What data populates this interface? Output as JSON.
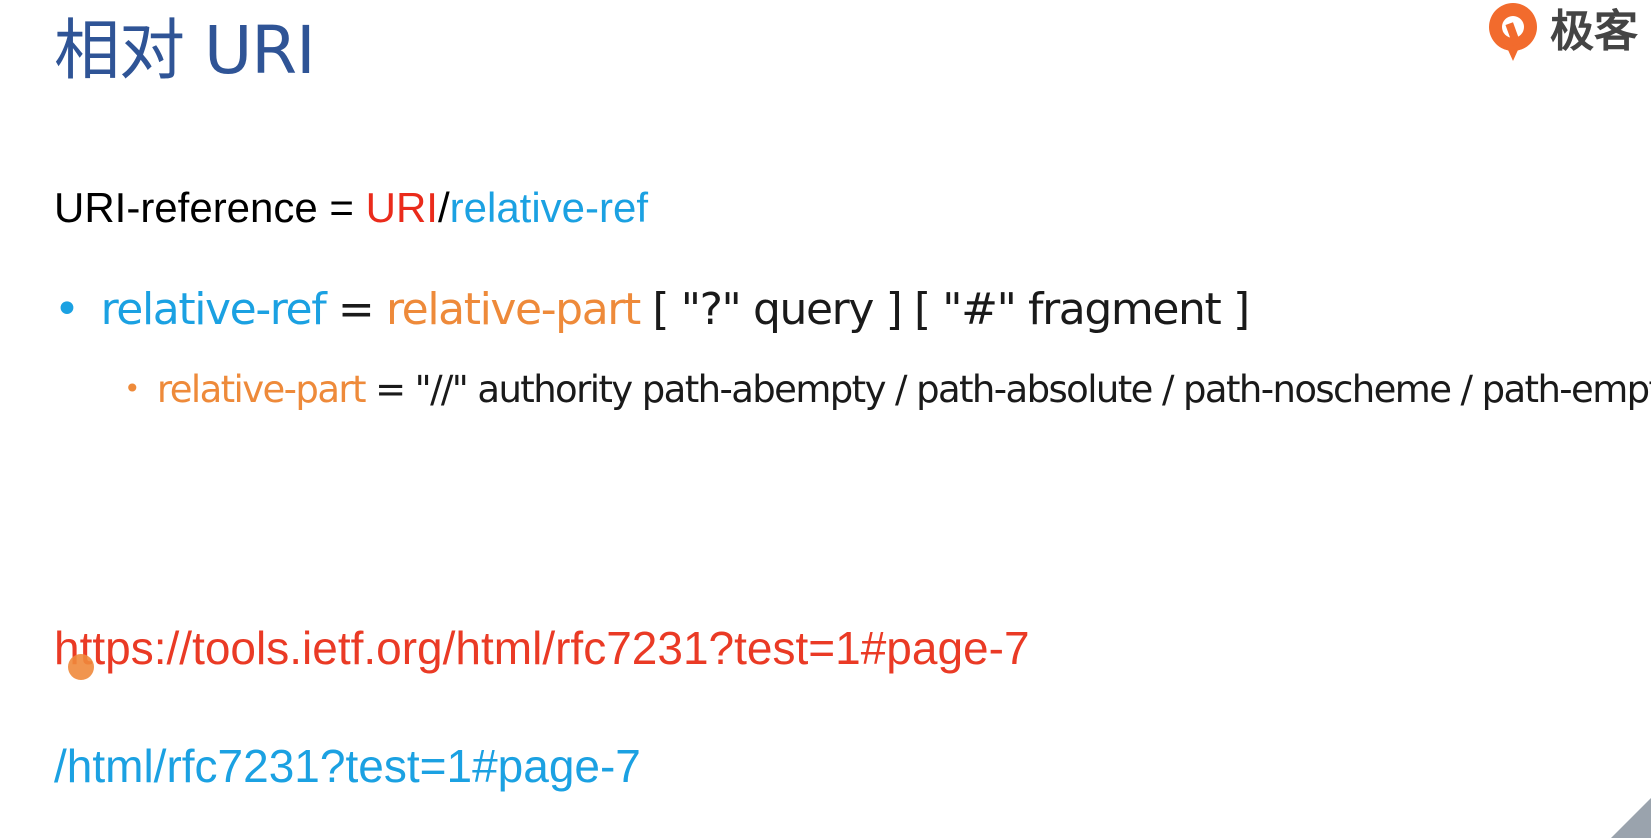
{
  "slide": {
    "title": "相对 URI",
    "logo": {
      "icon": "geekbang-logo-icon",
      "text": "极客",
      "color": "#f26b2d"
    },
    "definition": {
      "lhs": "URI-reference = ",
      "uri": "URI",
      "sep": "/",
      "relative_ref": "relative-ref"
    },
    "bullet1": {
      "relative_ref": "relative-ref",
      "eq": " = ",
      "relative_part": "relative-part",
      "rest": " [ \"?\" query ] [ \"#\" fragment ]"
    },
    "bullet2": {
      "relative_part": "relative-part",
      "rest": " = \"//\" authority path-abempty / path-absolute / path-noscheme / path-empty"
    },
    "absolute_url": "https://tools.ietf.org/html/rfc7231?test=1#page-7",
    "relative_url": "/html/rfc7231?test=1#page-7",
    "colors": {
      "title": "#2f5496",
      "uri_red": "#ea2b1b",
      "blue": "#1ba1e2",
      "orange": "#ee8a3a",
      "url_red": "#ea3a25"
    }
  }
}
